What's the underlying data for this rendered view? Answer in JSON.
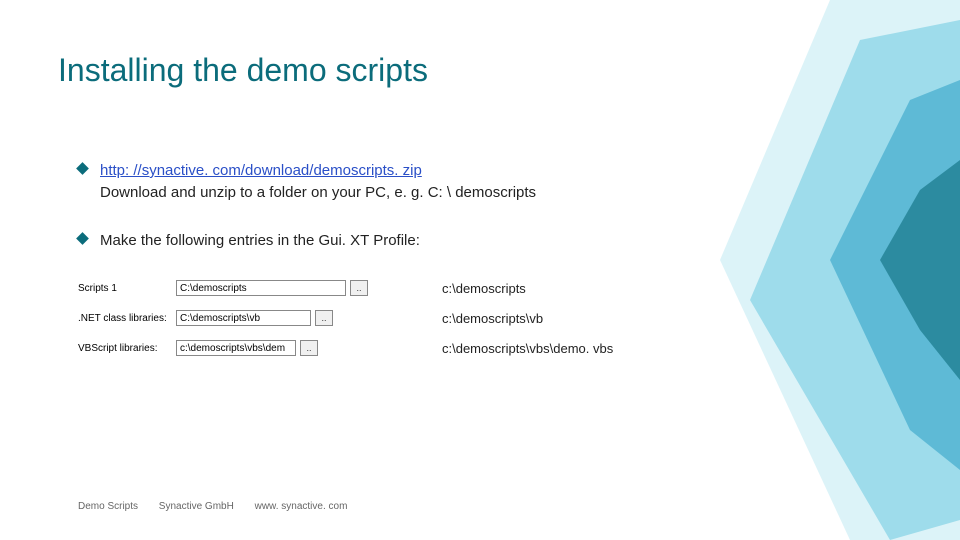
{
  "title": "Installing the demo scripts",
  "bullet1": {
    "link_text": "http: //synactive. com/download/demoscripts. zip",
    "desc": "Download and unzip to a folder on your PC, e. g. C: \\ demoscripts"
  },
  "bullet2": "Make the following entries in the Gui. XT Profile:",
  "entries": [
    {
      "label": "Scripts 1",
      "value": "C:\\demoscripts",
      "path": "c:\\demoscripts"
    },
    {
      "label": ".NET class libraries:",
      "value": "C:\\demoscripts\\vb",
      "path": "c:\\demoscripts\\vb"
    },
    {
      "label": "VBScript libraries:",
      "value": "c:\\demoscripts\\vbs\\dem",
      "path": "c:\\demoscripts\\vbs\\demo. vbs"
    }
  ],
  "browse": "..",
  "footer": {
    "a": "Demo Scripts",
    "b": "Synactive GmbH",
    "c": "www. synactive. com"
  }
}
